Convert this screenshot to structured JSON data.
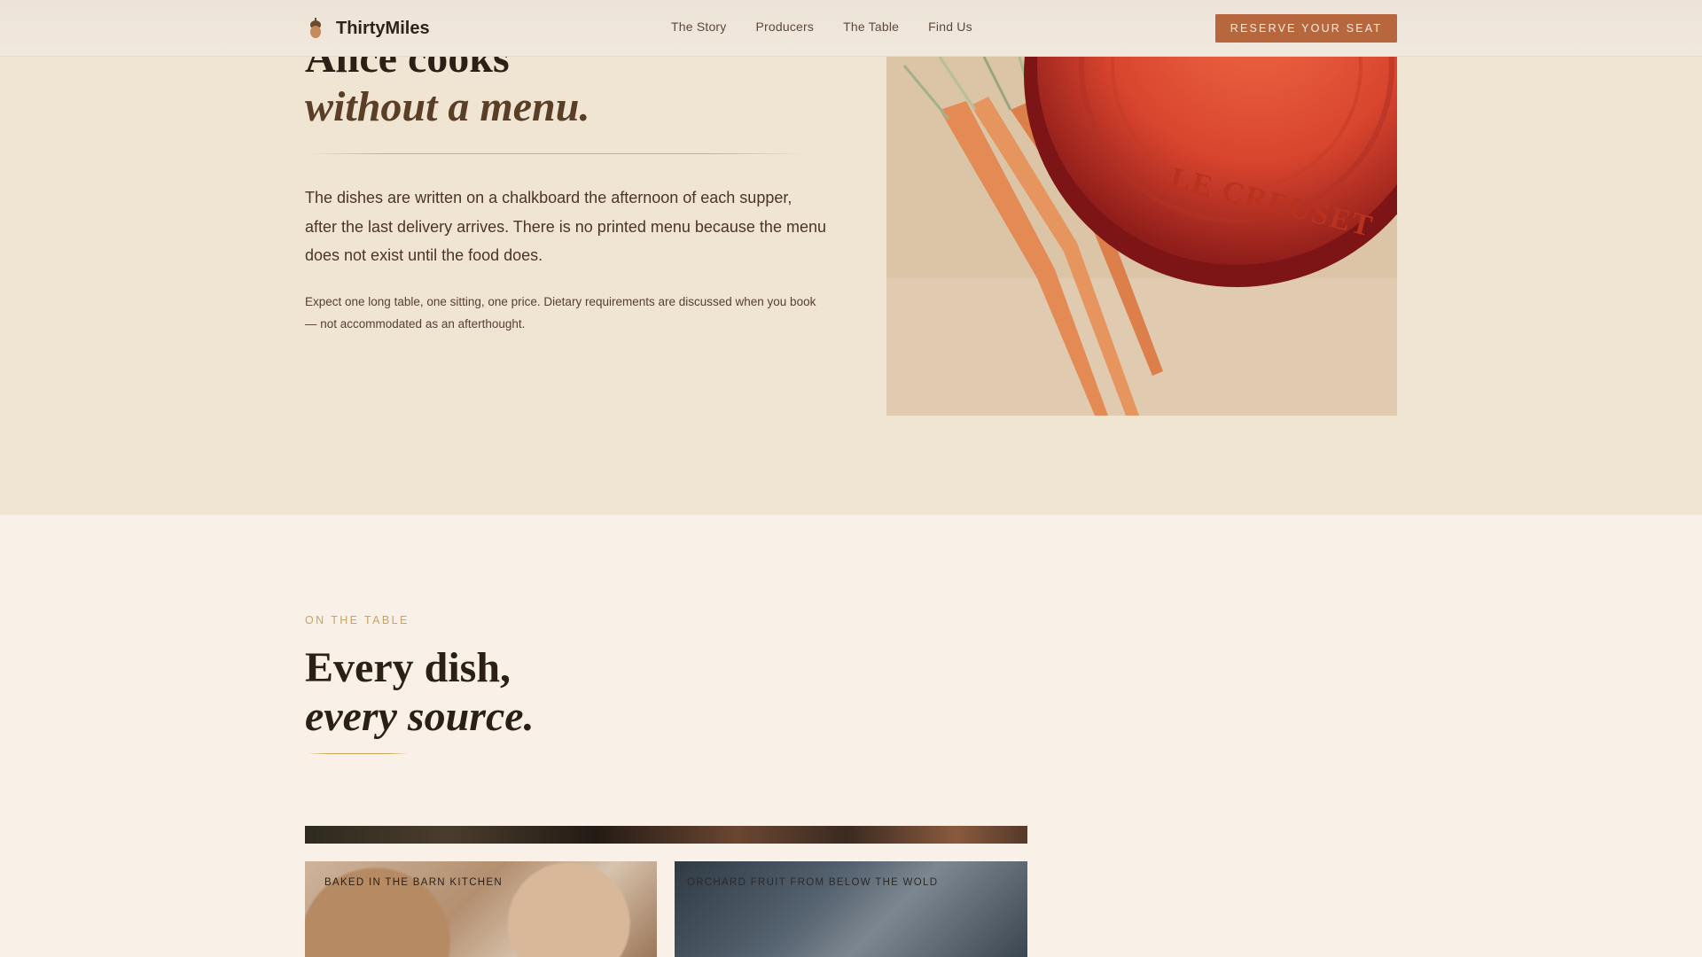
{
  "header": {
    "brand": "ThirtyMiles",
    "nav": [
      "The Story",
      "Producers",
      "The Table",
      "Find Us"
    ],
    "cta": "RESERVE YOUR SEAT"
  },
  "story": {
    "headline_line1": "Alice cooks",
    "headline_line2": "without a menu.",
    "lead": "The dishes are written on a chalkboard the afternoon of each supper, after the last delivery arrives. There is no printed menu because the menu does not exist until the food does.",
    "note": "Expect one long table, one sitting, one price. Dietary requirements are discussed when you book — not accommodated as an afterthought.",
    "photo_pot_text": "LE CREUSET"
  },
  "table_section": {
    "eyebrow": "ON THE TABLE",
    "title_line1": "Every dish,",
    "title_line2": "every source.",
    "cards": [
      {
        "label": "BAKED IN THE BARN KITCHEN"
      },
      {
        "label": "ORCHARD FRUIT FROM BELOW THE WOLD"
      }
    ]
  },
  "colors": {
    "accent": "#b7673d",
    "gold": "#c9a45a",
    "story_bg": "#f0e4d3",
    "page_bg": "#f9f1e8"
  }
}
